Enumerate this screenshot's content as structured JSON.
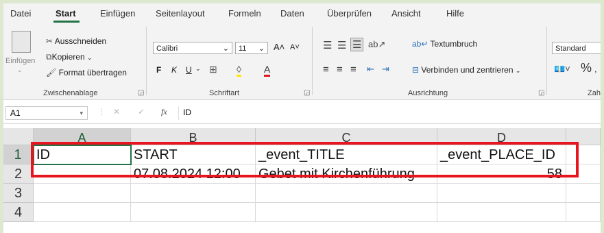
{
  "menu": {
    "tabs": [
      "Datei",
      "Start",
      "Einfügen",
      "Seitenlayout",
      "Formeln",
      "Daten",
      "Überprüfen",
      "Ansicht",
      "Hilfe"
    ]
  },
  "clipboard": {
    "paste": "Einfügen",
    "cut": "Ausschneiden",
    "copy": "Kopieren",
    "format_painter": "Format übertragen",
    "group": "Zwischenablage"
  },
  "font": {
    "name": "Calibri",
    "size": "11",
    "bold": "F",
    "italic": "K",
    "underline": "U",
    "color_letter": "A",
    "group": "Schriftart"
  },
  "alignment": {
    "wrap": "Textumbruch",
    "merge": "Verbinden und zentrieren",
    "group": "Ausrichtung"
  },
  "number": {
    "format": "Standard",
    "percent": "%",
    "group": "Zah"
  },
  "formula_bar": {
    "cell_ref": "A1",
    "fx": "fx",
    "content": "ID"
  },
  "grid": {
    "columns": [
      "A",
      "B",
      "C",
      "D"
    ],
    "rows": [
      "1",
      "2",
      "3",
      "4"
    ],
    "cells": {
      "A1": "ID",
      "B1": "START",
      "C1": "_event_TITLE",
      "D1": "_event_PLACE_ID",
      "A2": "",
      "B2": "07.08.2024 12:00",
      "C2": "Gebet mit Kirchenführung",
      "D2": "58"
    }
  },
  "colors": {
    "excel_green": "#217346",
    "annotation_red": "#e8141e",
    "background": "#dde8cf"
  }
}
